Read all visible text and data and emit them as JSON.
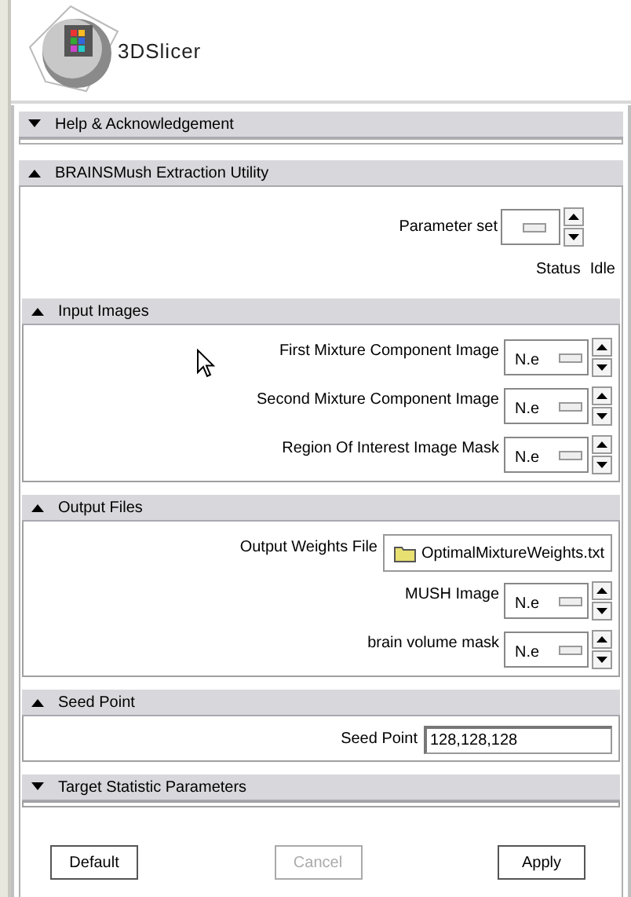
{
  "logo": {
    "text": "3DSlicer"
  },
  "modules": [
    {
      "title": "Help & Acknowledgement",
      "expanded": false
    },
    {
      "title": "BRAINSMush Extraction Utility",
      "expanded": true,
      "parameter_set": {
        "label": "Parameter set"
      },
      "status": {
        "label": "Status",
        "value": "Idle"
      },
      "groups": [
        {
          "title": "Input Images",
          "expanded": true,
          "rows": [
            {
              "kind": "node",
              "label": "First Mixture Component Image",
              "value": "N.e"
            },
            {
              "kind": "node",
              "label": "Second Mixture Component Image",
              "value": "N.e"
            },
            {
              "kind": "node",
              "label": "Region Of Interest Image Mask",
              "value": "N.e"
            }
          ]
        },
        {
          "title": "Output Files",
          "expanded": true,
          "rows": [
            {
              "kind": "file",
              "label": "Output Weights File",
              "value": "OptimalMixtureWeights.txt"
            },
            {
              "kind": "node",
              "label": "MUSH Image",
              "value": "N.e"
            },
            {
              "kind": "node",
              "label": "brain volume mask",
              "value": "N.e"
            }
          ]
        },
        {
          "title": "Seed Point",
          "expanded": true,
          "rows": [
            {
              "kind": "text",
              "label": "Seed Point",
              "value": "128,128,128"
            }
          ]
        },
        {
          "title": "Target Statistic Parameters",
          "expanded": false
        }
      ],
      "buttons": [
        {
          "label": "Default",
          "disabled": false
        },
        {
          "label": "Cancel",
          "disabled": true
        },
        {
          "label": "Apply",
          "disabled": false
        }
      ]
    }
  ]
}
